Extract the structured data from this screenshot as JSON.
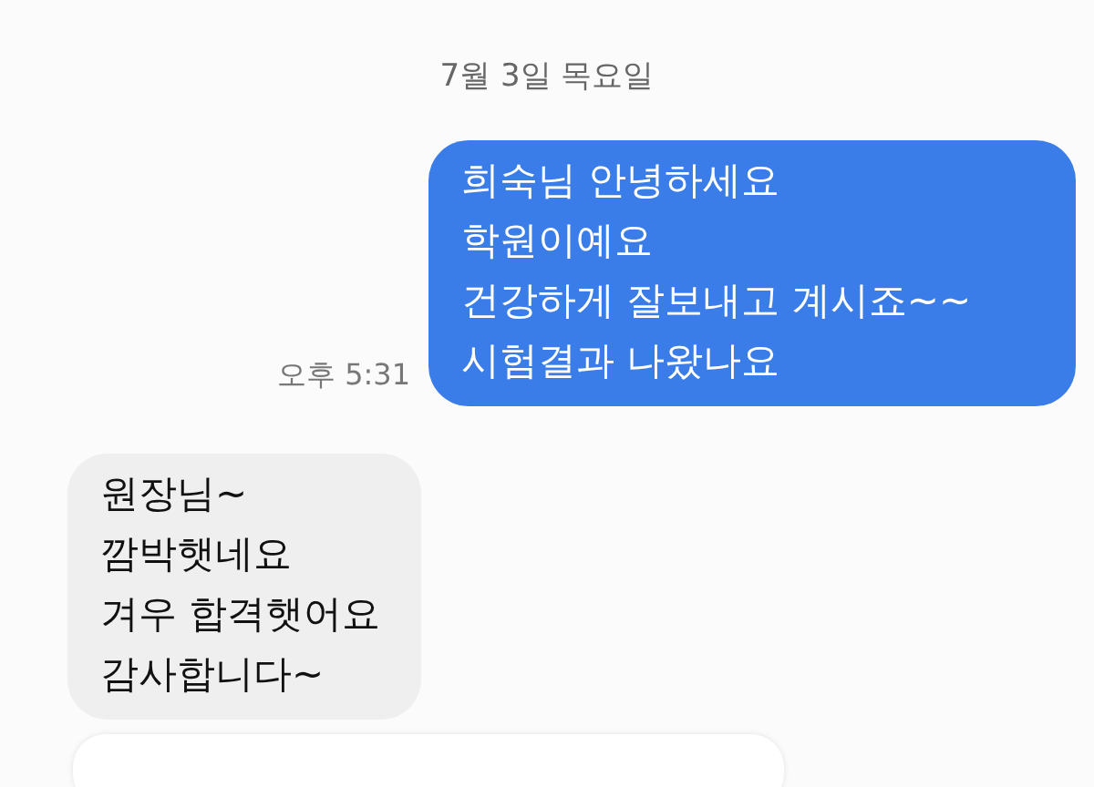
{
  "date_divider": "7월 3일 목요일",
  "messages": [
    {
      "kind": "sent",
      "text": "희숙님 안녕하세요\n학원이예요\n건강하게 잘보내고 계시죠~~\n시험결과 나왔나요",
      "time": "오후 5:31"
    },
    {
      "kind": "received",
      "text": "원장님~\n깜박햇네요\n겨우 합격햇어요\n감사합니다~"
    }
  ]
}
